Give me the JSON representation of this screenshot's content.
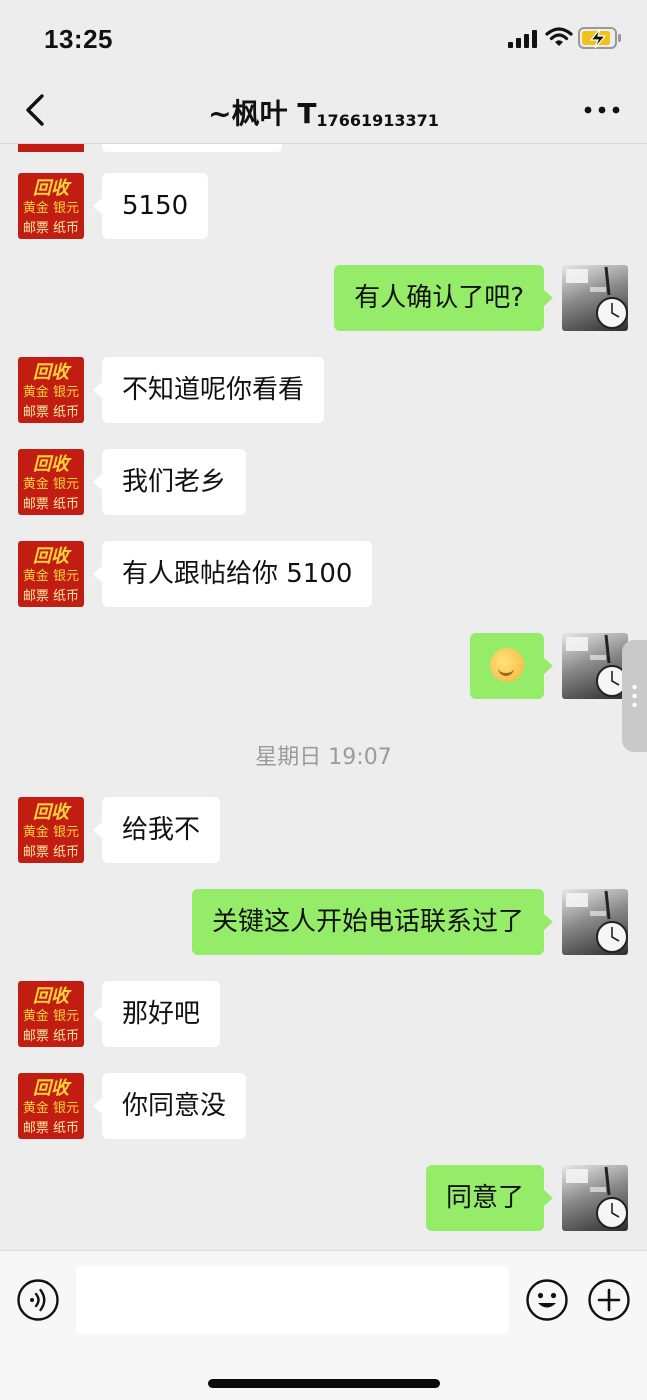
{
  "status_bar": {
    "time": "13:25"
  },
  "header": {
    "title_name": "~枫叶 T",
    "title_sub": "17661913371"
  },
  "left_avatar": {
    "top": "回收",
    "mid": "黄金 银元",
    "bot": "邮票 纸币"
  },
  "messages": [
    {
      "side": "left",
      "text": "5150"
    },
    {
      "side": "right",
      "text": "有人确认了吧?"
    },
    {
      "side": "left",
      "text": "不知道呢你看看"
    },
    {
      "side": "left",
      "text": "我们老乡"
    },
    {
      "side": "left",
      "text": "有人跟帖给你 5100"
    },
    {
      "side": "right",
      "text": "",
      "emoji": "emoji-face-icon"
    },
    {
      "type": "time",
      "text": "星期日 19:07"
    },
    {
      "side": "left",
      "text": "给我不"
    },
    {
      "side": "right",
      "text": "关键这人开始电话联系过了"
    },
    {
      "side": "left",
      "text": "那好吧"
    },
    {
      "side": "left",
      "text": "你同意没"
    },
    {
      "side": "right",
      "text": "同意了"
    }
  ],
  "input": {
    "value": "",
    "placeholder": ""
  },
  "colors": {
    "background": "#ededed",
    "bubble_self": "#95ec69",
    "bubble_other": "#ffffff",
    "avatar_red": "#c21d12"
  },
  "icons": [
    "signal-icon",
    "wifi-icon",
    "battery-charging-icon",
    "back-arrow-icon",
    "more-icon",
    "voice-icon",
    "emoji-icon",
    "plus-icon"
  ]
}
